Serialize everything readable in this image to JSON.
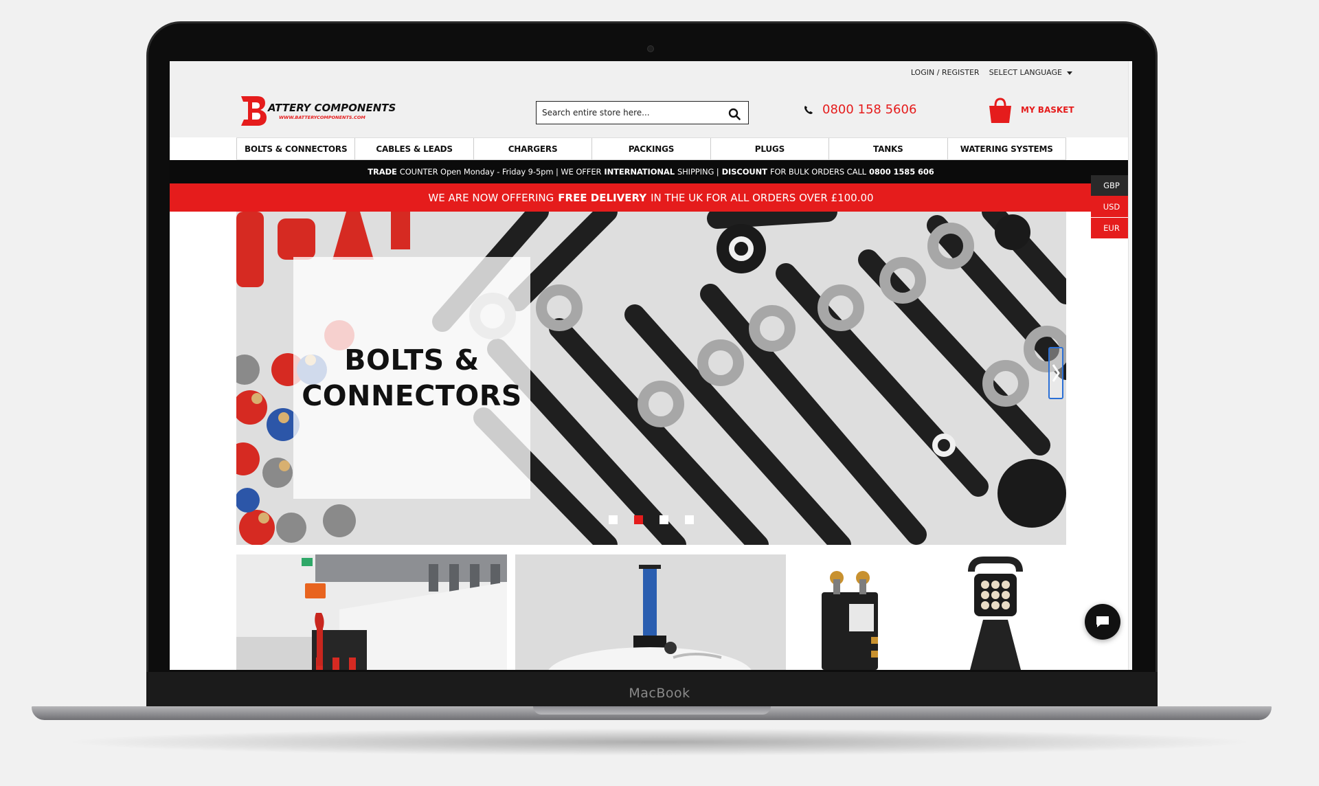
{
  "device": {
    "brand": "MacBook"
  },
  "header": {
    "login_register": "LOGIN / REGISTER",
    "select_language": "SELECT LANGUAGE",
    "logo_text": "ATTERY COMPONENTS",
    "logo_subtext": "WWW.BATTERYCOMPONENTS.COM",
    "search_placeholder": "Search entire store here...",
    "phone": "0800 158 5606",
    "basket": "MY BASKET"
  },
  "nav": {
    "items": [
      "BOLTS & CONNECTORS",
      "CABLES & LEADS",
      "CHARGERS",
      "PACKINGS",
      "PLUGS",
      "TANKS",
      "WATERING SYSTEMS"
    ]
  },
  "infobar": {
    "part1_bold": "TRADE",
    "part1": "COUNTER Open Monday - Friday 9-5pm | WE OFFER",
    "part2_bold": "INTERNATIONAL",
    "part2": "SHIPPING |",
    "part3_bold": "DISCOUNT",
    "part3": "FOR BULK ORDERS CALL",
    "phone_bold": "0800 1585 606"
  },
  "promo": {
    "before": "WE ARE NOW OFFERING",
    "bold": "FREE DELIVERY",
    "after": "IN THE UK FOR ALL ORDERS OVER £100.00"
  },
  "currency": [
    "GBP",
    "USD",
    "EUR"
  ],
  "banner": {
    "line1": "BOLTS &",
    "line2": "CONNECTORS",
    "slides": 4,
    "active_slide": 2
  },
  "colors": {
    "accent": "#e51c1c",
    "dark": "#0b0b0b"
  }
}
